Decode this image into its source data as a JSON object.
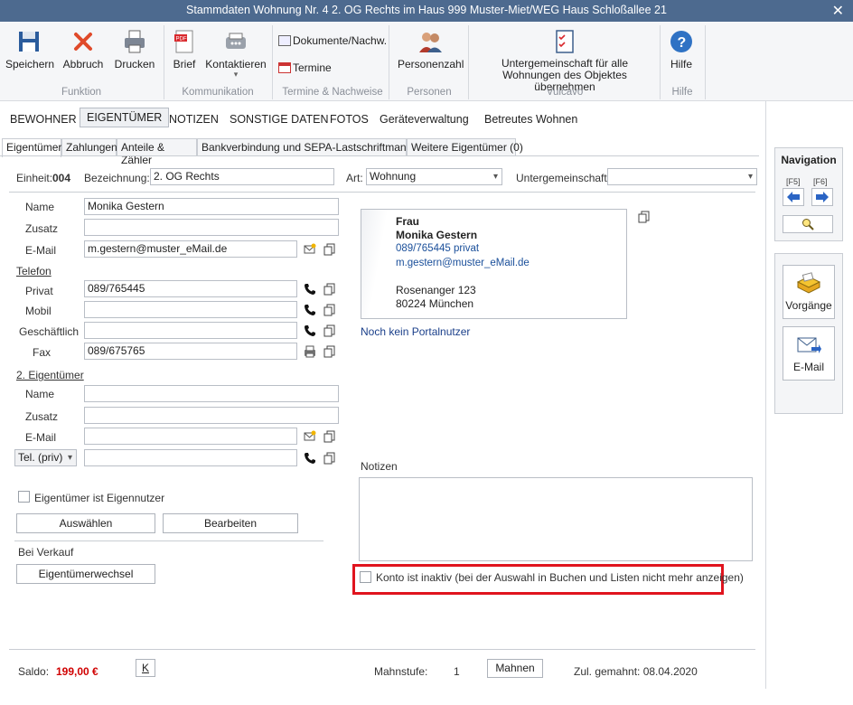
{
  "window": {
    "title": "Stammdaten Wohnung Nr. 4 2. OG Rechts im Haus 999  Muster-Miet/WEG Haus Schloßallee 21",
    "close": "✕"
  },
  "ribbon": {
    "speichern": "Speichern",
    "abbruch": "Abbruch",
    "drucken": "Drucken",
    "brief": "Brief",
    "kontaktieren": "Kontaktieren",
    "kontaktieren_arrow": "▾",
    "dokumente": "Dokumente/Nachw.",
    "termine": "Termine",
    "personenzahl": "Personenzahl",
    "untergemeinschaft_line1": "Untergemeinschaft für alle",
    "untergemeinschaft_line2": "Wohnungen des Objektes übernehmen",
    "hilfe": "Hilfe",
    "groups": {
      "funktion": "Funktion",
      "kommunikation": "Kommunikation",
      "termine_nachweise": "Termine & Nachweise",
      "personen": "Personen",
      "vulcavo": "Vulcavo",
      "hilfe": "Hilfe"
    }
  },
  "main_tabs": [
    "BEWOHNER",
    "EIGENTÜMER",
    "NOTIZEN",
    "SONSTIGE DATEN",
    "FOTOS",
    "Geräteverwaltung",
    "Betreutes Wohnen"
  ],
  "sub_tabs": [
    "Eigentümer",
    "Zahlungen",
    "Anteile & Zähler",
    "Bankverbindung und SEPA-Lastschriftmandat",
    "Weitere Eigentümer (0)"
  ],
  "header": {
    "einheit_label": "Einheit:",
    "einheit_value": "004",
    "bezeichnung_label": "Bezeichnung:",
    "bezeichnung_value": "2. OG Rechts",
    "art_label": "Art:",
    "art_value": "Wohnung",
    "untergemeinschaft_label": "Untergemeinschaft",
    "untergemeinschaft_value": ""
  },
  "owner1": {
    "name_label": "Name",
    "name_value": "Monika Gestern",
    "zusatz_label": "Zusatz",
    "zusatz_value": "",
    "email_label": "E-Mail",
    "email_value": "m.gestern@muster_eMail.de",
    "telefon_label": "Telefon",
    "privat_label": "Privat",
    "privat_value": "089/765445",
    "mobil_label": "Mobil",
    "mobil_value": "",
    "geschaeftlich_label": "Geschäftlich",
    "geschaeftlich_value": "",
    "fax_label": "Fax",
    "fax_value": "089/675765"
  },
  "owner2": {
    "title": "2. Eigentümer",
    "name_label": "Name",
    "name_value": "",
    "zusatz_label": "Zusatz",
    "zusatz_value": "",
    "email_label": "E-Mail",
    "email_value": "",
    "tel_select": "Tel. (priv)",
    "tel_value": ""
  },
  "card": {
    "anrede": "Frau",
    "name": "Monika Gestern",
    "phone": "089/765445 privat",
    "email": "m.gestern@muster_eMail.de",
    "street": "Rosenanger 123",
    "city": "80224 München",
    "portal": "Noch kein Portalnutzer"
  },
  "eigennutzer_label": "Eigentümer ist Eigennutzer",
  "auswaehlen": "Auswählen",
  "bearbeiten": "Bearbeiten",
  "bei_verkauf": "Bei Verkauf",
  "eigentuemerwechsel": "Eigentümerwechsel",
  "notizen_label": "Notizen",
  "notizen_value": "",
  "konto_inaktiv": "Konto ist inaktiv (bei der Auswahl in Buchen und Listen nicht mehr anzeigen)",
  "footer": {
    "saldo_label": "Saldo:",
    "saldo_value": "199,00 €",
    "k_button": "K",
    "mahnstufe_label": "Mahnstufe:",
    "mahnstufe_value": "1",
    "mahnen": "Mahnen",
    "zul_gemahnt": "Zul. gemahnt: 08.04.2020"
  },
  "navigation": {
    "title": "Navigation",
    "f5": "[F5]",
    "f6": "[F6]"
  },
  "side": {
    "vorgaenge": "Vorgänge",
    "email": "E-Mail"
  },
  "colors": {
    "titlebar": "#4d6a8f",
    "highlight": "#e0141e",
    "saldo": "#d00000",
    "link": "#1a4f9a"
  }
}
